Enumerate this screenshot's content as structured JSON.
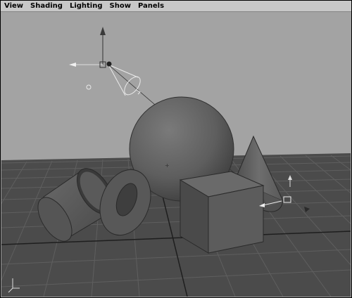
{
  "menubar": {
    "items": [
      {
        "label": "View"
      },
      {
        "label": "Shading"
      },
      {
        "label": "Lighting"
      },
      {
        "label": "Show"
      },
      {
        "label": "Panels"
      }
    ]
  },
  "viewport": {
    "background_color": "#a3a3a3",
    "grid_color": "#555555",
    "floor_color": "#4a4a4a",
    "objects": [
      "sphere",
      "cube",
      "cone",
      "cylinder",
      "torus",
      "spotlight"
    ],
    "axis_indicator_icon": "xyz-axis-icon"
  }
}
